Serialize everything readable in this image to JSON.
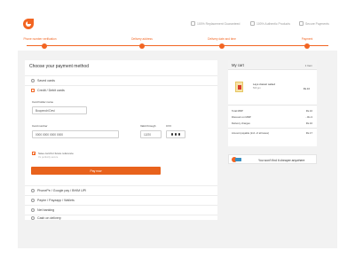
{
  "header": {
    "trust_items": [
      {
        "icon": "replacement-icon",
        "label": "100% Replacement Guaranteed"
      },
      {
        "icon": "authentic-icon",
        "label": "100% Authentic Products"
      },
      {
        "icon": "secure-icon",
        "label": "Secure Payments"
      }
    ]
  },
  "steps": [
    "Phone number verification",
    "Delivery address",
    "Delivery date and time",
    "Payment"
  ],
  "payment": {
    "title": "Choose your payment method",
    "methods": {
      "saved": "Saved cards",
      "card": "Credit / Debit cards",
      "upi": "PhonePe / Google pay / BHIM UPI",
      "wallet": "Paytm / Payzapp / Wallets",
      "netbanking": "Net banking",
      "cod": "Cash on delivery"
    },
    "card_form": {
      "holder_label": "Card holder name",
      "holder_value": "Boopendri Devi",
      "number_label": "Card number",
      "number_value": "0000 0000 0000 0000",
      "valid_label": "Valid through",
      "valid_value": "12/20",
      "cvv_label": "CVV",
      "save_label": "Save card for future reference",
      "save_sub": "It's perfectly secure"
    },
    "pay_button": "Pay now"
  },
  "cart": {
    "title": "My cart",
    "count": "1 Item",
    "item": {
      "name": "Lays classic salted",
      "size": "500 gm",
      "price": "Rs.10"
    },
    "summary": [
      {
        "label": "Total MRP",
        "value": "Rs.10"
      },
      {
        "label": "Discount on MRP",
        "value": "- Rs.3"
      },
      {
        "label": "Delivery charges",
        "value": "Rs.10"
      },
      {
        "label": "Amount payable (incl. of all taxes)",
        "value": "Rs.17"
      }
    ]
  },
  "promo": {
    "text": "You won't find it cheaper anywhere"
  },
  "colors": {
    "accent": "#f26522",
    "background": "#f2f2f2"
  }
}
